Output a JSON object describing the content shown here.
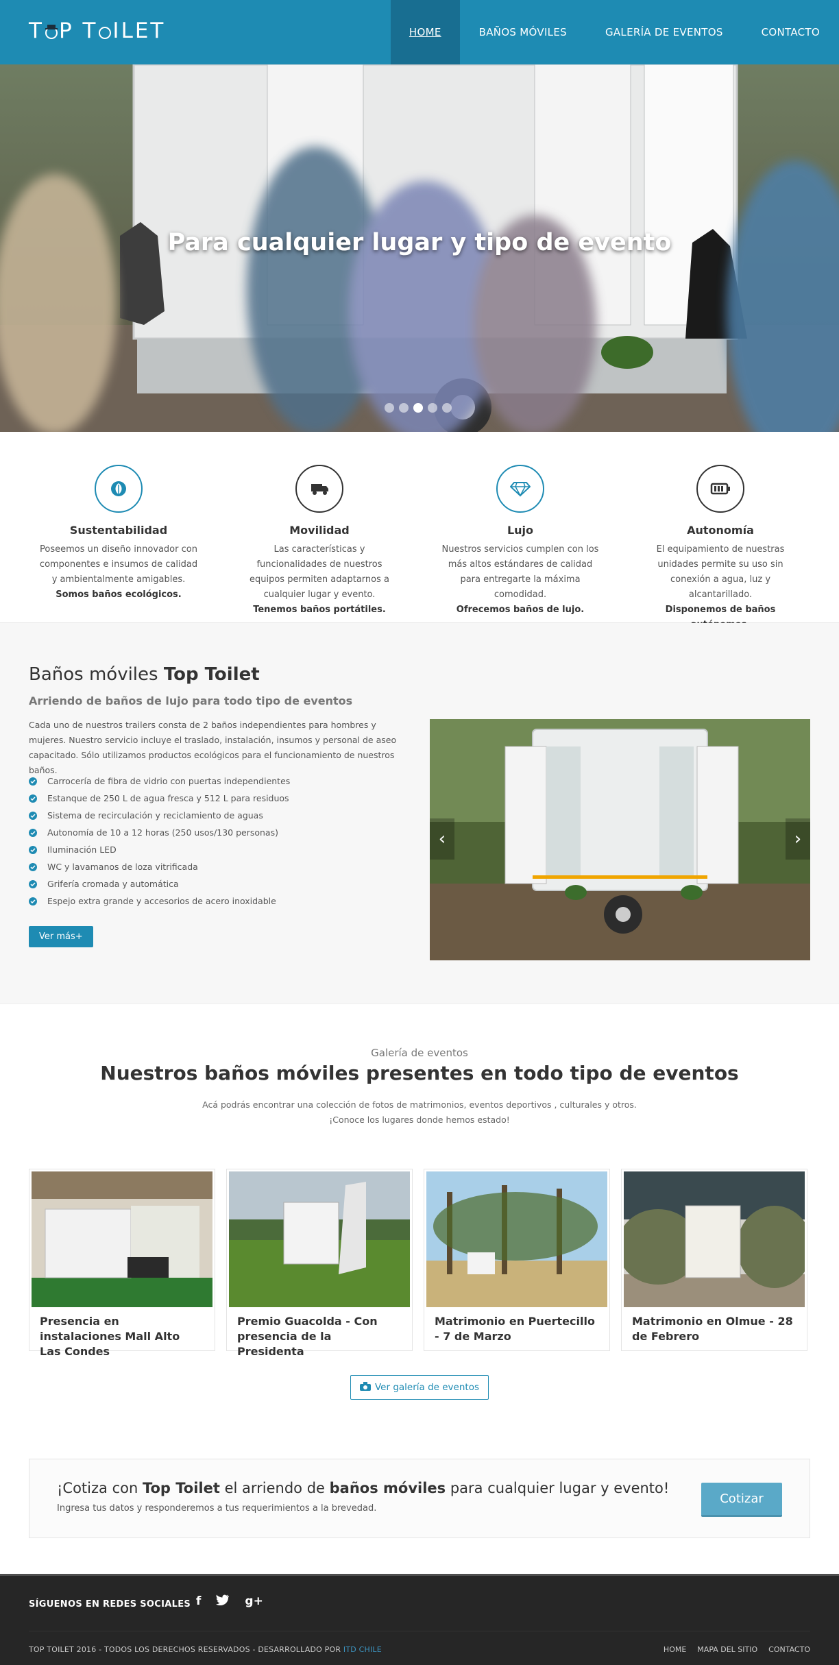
{
  "nav": {
    "logo": "TOP TOILET",
    "items": [
      {
        "label": "HOME",
        "active": true
      },
      {
        "label": "BAÑOS MÓVILES"
      },
      {
        "label": "GALERÍA DE EVENTOS"
      },
      {
        "label": "CONTACTO"
      }
    ]
  },
  "hero": {
    "caption": "Para cualquier lugar y tipo de evento",
    "slide_count": 5,
    "active_slide": 2
  },
  "features": [
    {
      "icon": "leaf-icon",
      "title": "Sustentabilidad",
      "text": "Poseemos un diseño innovador con componentes e insumos de calidad y ambientalmente amigables.",
      "strong": "Somos baños ecológicos."
    },
    {
      "icon": "truck-icon",
      "title": "Movilidad",
      "text": "Las características y funcionalidades de nuestros equipos permiten adaptarnos a cualquier lugar y evento.",
      "strong": "Tenemos baños portátiles."
    },
    {
      "icon": "diamond-icon",
      "title": "Lujo",
      "text": "Nuestros servicios cumplen con los más altos estándares de calidad para entregarte la máxima comodidad.",
      "strong": "Ofrecemos baños de lujo."
    },
    {
      "icon": "battery-icon",
      "title": "Autonomía",
      "text": "El equipamiento de nuestras unidades permite su uso sin conexión a agua, luz y alcantarillado.",
      "strong": "Disponemos de baños autónomos."
    }
  ],
  "about": {
    "title_pre": "Baños móviles ",
    "title_bold": "Top Toilet",
    "subtitle": "Arriendo de baños de lujo para todo tipo de eventos",
    "desc": "Cada uno de nuestros trailers consta de 2 baños independientes para hombres y mujeres. Nuestro servicio incluye el traslado, instalación, insumos y personal de aseo capacitado. Sólo utilizamos productos ecológicos para el funcionamiento de nuestros baños.",
    "list": [
      "Carrocería de fibra de vidrio con puertas independientes",
      "Estanque de 250 L de agua fresca y 512 L para residuos",
      "Sistema de recirculación y reciclamiento de aguas",
      "Autonomía de 10 a 12 horas (250 usos/130 personas)",
      "Iluminación LED",
      "WC y lavamanos de loza vitrificada",
      "Grifería cromada y automática",
      "Espejo extra grande y accesorios de acero inoxidable"
    ],
    "button": "Ver más+",
    "prev": "‹",
    "next": "›"
  },
  "gallery": {
    "kicker": "Galería de eventos",
    "title_pre": "Nuestros ",
    "title_bold": "baños móviles",
    "title_post": " presentes en todo tipo de eventos",
    "intro_1": "Acá podrás encontrar una colección de fotos de matrimonios, eventos deportivos , culturales y otros.",
    "intro_2": "¡Conoce los lugares donde hemos estado!",
    "cards": [
      {
        "title": "Presencia en instalaciones Mall Alto Las Condes"
      },
      {
        "title": "Premio Guacolda - Con presencia de la Presidenta"
      },
      {
        "title": "Matrimonio en Puertecillo - 7 de Marzo"
      },
      {
        "title": "Matrimonio en Olmue - 28 de Febrero"
      }
    ],
    "button": "Ver galería de eventos"
  },
  "quote": {
    "t1": "¡Cotiza con ",
    "t2": "Top Toilet",
    "t3": " el arriendo de ",
    "t4": "baños móviles",
    "t5": " para cualquier lugar y evento!",
    "sub": "Ingresa tus datos y responderemos a tus requerimientos a la brevedad.",
    "button": "Cotizar"
  },
  "footer": {
    "social_title": "SÍGUENOS EN REDES SOCIALES",
    "social": [
      "f",
      "twitter",
      "g+"
    ],
    "copyright": "TOP TOILET 2016 - TODOS LOS DERECHOS RESERVADOS - DESARROLLADO POR ",
    "dev": "ITD CHILE",
    "links": [
      "HOME",
      "MAPA DEL SITIO",
      "CONTACTO"
    ]
  },
  "colors": {
    "primary": "#1e8bb3",
    "dark": "#262626",
    "button_light": "#5aa9c8"
  }
}
